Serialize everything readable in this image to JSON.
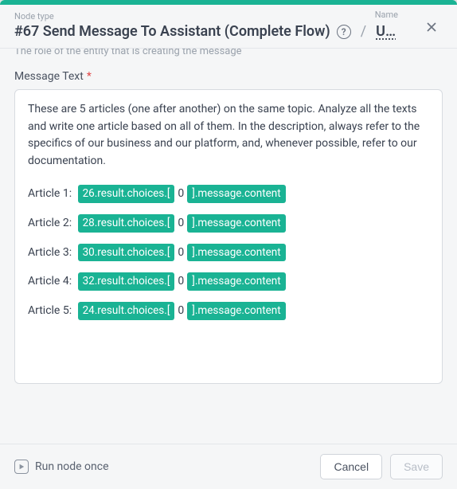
{
  "header": {
    "meta_node_type_label": "Node type",
    "meta_name_label": "Name",
    "title": "#67 Send Message To Assistant (Complete Flow)",
    "name_value": "U…"
  },
  "cutoff_help": "The role of the entity that is creating the message",
  "field_label": "Message Text",
  "message": {
    "intro": "These are 5 articles (one after another) on the same topic. Analyze all the texts and write one article based on all of them. In the description, always refer to the specifics of our business and our platform, and, whenever possible, refer to our documentation.",
    "articles": [
      {
        "label": "Article 1:",
        "pill_left": "26.result.choices.[",
        "mid": "0",
        "pill_right": "].message.content"
      },
      {
        "label": "Article 2:",
        "pill_left": "28.result.choices.[",
        "mid": "0",
        "pill_right": "].message.content"
      },
      {
        "label": "Article 3:",
        "pill_left": "30.result.choices.[",
        "mid": "0",
        "pill_right": "].message.content"
      },
      {
        "label": "Article 4:",
        "pill_left": "32.result.choices.[",
        "mid": "0",
        "pill_right": "].message.content"
      },
      {
        "label": "Article 5:",
        "pill_left": "24.result.choices.[",
        "mid": "0",
        "pill_right": "].message.content"
      }
    ]
  },
  "footer": {
    "run_label": "Run node once",
    "cancel": "Cancel",
    "save": "Save"
  }
}
